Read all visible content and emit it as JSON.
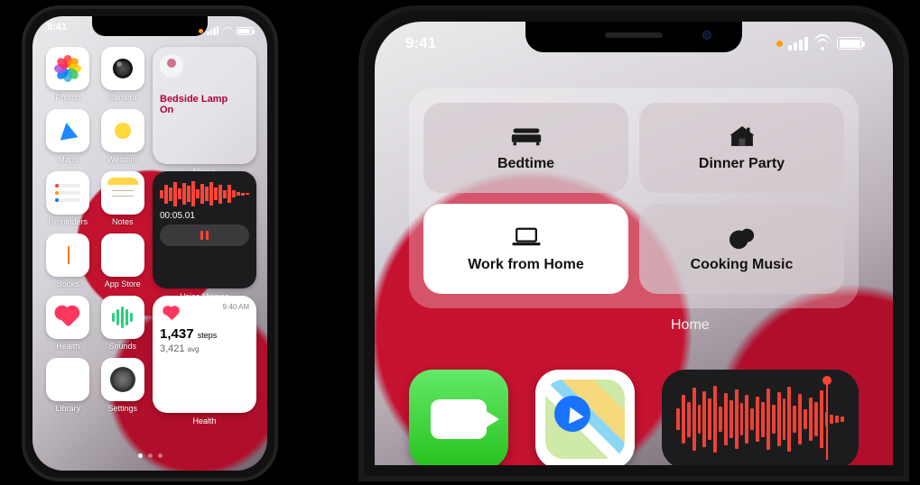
{
  "status": {
    "time": "9:41"
  },
  "left_phone": {
    "apps_row1": [
      {
        "label": "Photos",
        "icon": "photos-icon"
      },
      {
        "label": "Camera",
        "icon": "camera-icon"
      }
    ],
    "apps_row2": [
      {
        "label": "Maps",
        "icon": "maps-icon"
      },
      {
        "label": "Weather",
        "icon": "weather-icon"
      }
    ],
    "apps_row3": [
      {
        "label": "Reminders",
        "icon": "reminders-icon"
      },
      {
        "label": "Notes",
        "icon": "notes-icon"
      }
    ],
    "apps_row4": [
      {
        "label": "Books",
        "icon": "books-icon"
      },
      {
        "label": "App Store",
        "icon": "app-store-icon"
      }
    ],
    "apps_row5": [
      {
        "label": "Health",
        "icon": "health-icon"
      },
      {
        "label": "Sounds",
        "icon": "sounds-icon"
      }
    ],
    "apps_row6": [
      {
        "label": "Library",
        "icon": "library-icon"
      },
      {
        "label": "Settings",
        "icon": "settings-icon"
      }
    ],
    "home_widget": {
      "device": "Bedside Lamp",
      "state": "On",
      "label": "Home"
    },
    "voice_widget": {
      "elapsed": "00:05.01",
      "label": "Voice Memos"
    },
    "health_widget": {
      "timestamp": "9:40 AM",
      "steps_value": "1,437",
      "steps_unit": "steps",
      "avg_value": "3,421",
      "avg_unit": "avg",
      "label": "Health"
    }
  },
  "right_phone": {
    "scenes": [
      {
        "label": "Bedtime",
        "icon": "bed-icon",
        "active": false
      },
      {
        "label": "Dinner Party",
        "icon": "house-icon",
        "active": false
      },
      {
        "label": "Work from Home",
        "icon": "laptop-icon",
        "active": true
      },
      {
        "label": "Cooking Music",
        "icon": "fruit-icon",
        "active": false
      }
    ],
    "scenes_label": "Home",
    "bottom_apps": [
      {
        "name": "FaceTime",
        "icon": "facetime-icon"
      },
      {
        "name": "Maps",
        "icon": "maps-icon"
      },
      {
        "name": "Voice Memos",
        "icon": "voice-memos-widget"
      }
    ]
  }
}
